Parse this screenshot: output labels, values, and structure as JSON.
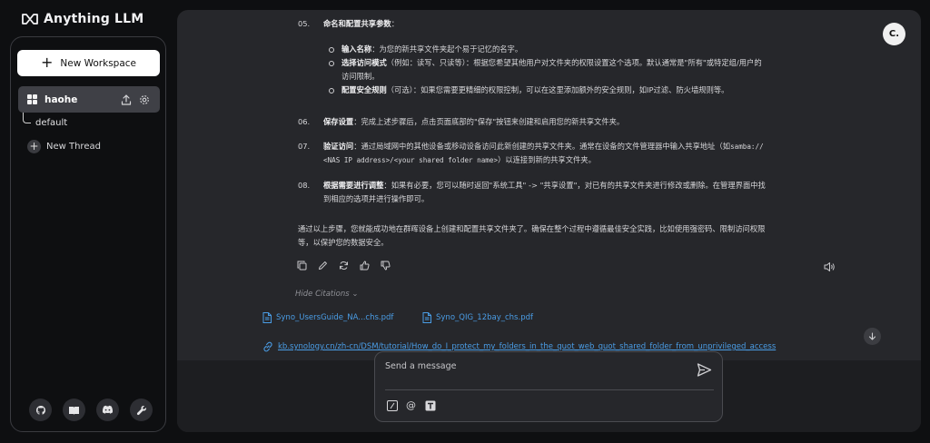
{
  "app": {
    "name": "Anything LLM"
  },
  "sidebar": {
    "new_workspace_label": "New Workspace",
    "workspace": {
      "name": "haohe"
    },
    "threads": [
      {
        "label": "default"
      }
    ],
    "new_thread_label": "New Thread",
    "footer_icons": [
      "github-icon",
      "book-icon",
      "discord-icon",
      "wrench-icon"
    ]
  },
  "user": {
    "avatar_initial": "C."
  },
  "message": {
    "item05": {
      "num": "05.",
      "title": "命名和配置共享参数",
      "tail": "："
    },
    "bullets": [
      {
        "title": "输入名称",
        "text": "：为您的新共享文件夹起个易于记忆的名字。"
      },
      {
        "title": "选择访问模式",
        "text": "（例如：读写、只读等）：根据您希望其他用户对文件夹的权限设置这个选项。默认通常是\"所有\"或特定组/用户的",
        "text2": "访问限制。"
      },
      {
        "title": "配置安全规则",
        "text": "（可选）：如果您需要更精细的权限控制，可以在这里添加额外的安全规则，如IP过滤、防火墙规则等。"
      }
    ],
    "item06": {
      "num": "06.",
      "title": "保存设置",
      "text": "：完成上述步骤后，点击页面底部的\"保存\"按钮来创建和启用您的新共享文件夹。"
    },
    "item07": {
      "num": "07.",
      "title": "验证访问",
      "text": "：通过局域网中的其他设备或移动设备访问此新创建的共享文件夹。通常在设备的文件管理器中输入共享地址（如",
      "code1": "samba://",
      "code2": "<NAS IP address>/<your shared folder name>",
      "text2": "）以连接到新的共享文件夹。"
    },
    "item08": {
      "num": "08.",
      "title": "根据需要进行调整",
      "text": "：如果有必要，您可以随时返回\"系统工具\" -> \"共享设置\"，对已有的共享文件夹进行修改或删除。在管理界面中找",
      "text2": "到相应的选项并进行操作即可。"
    },
    "summary1": "通过以上步骤，您就能成功地在群晖设备上创建和配置共享文件夹了。确保在整个过程中遵循最佳安全实践，比如使用强密码、限制访问权限",
    "summary2": "等，以保护您的数据安全。"
  },
  "citations": {
    "toggle_label": "Hide Citations",
    "files": [
      "Syno_UsersGuide_NA...chs.pdf",
      "Syno_QIG_12bay_chs.pdf"
    ],
    "link": "kb.synology.cn/zh-cn/DSM/tutorial/How_do_I_protect_my_folders_in_the_quot_web_quot_shared_folder_from_unprivileged_access"
  },
  "composer": {
    "placeholder": "Send a message"
  },
  "colors": {
    "accent_link": "#4a9de6",
    "main_bg": "#26272b",
    "page_bg": "#0e0f11"
  }
}
